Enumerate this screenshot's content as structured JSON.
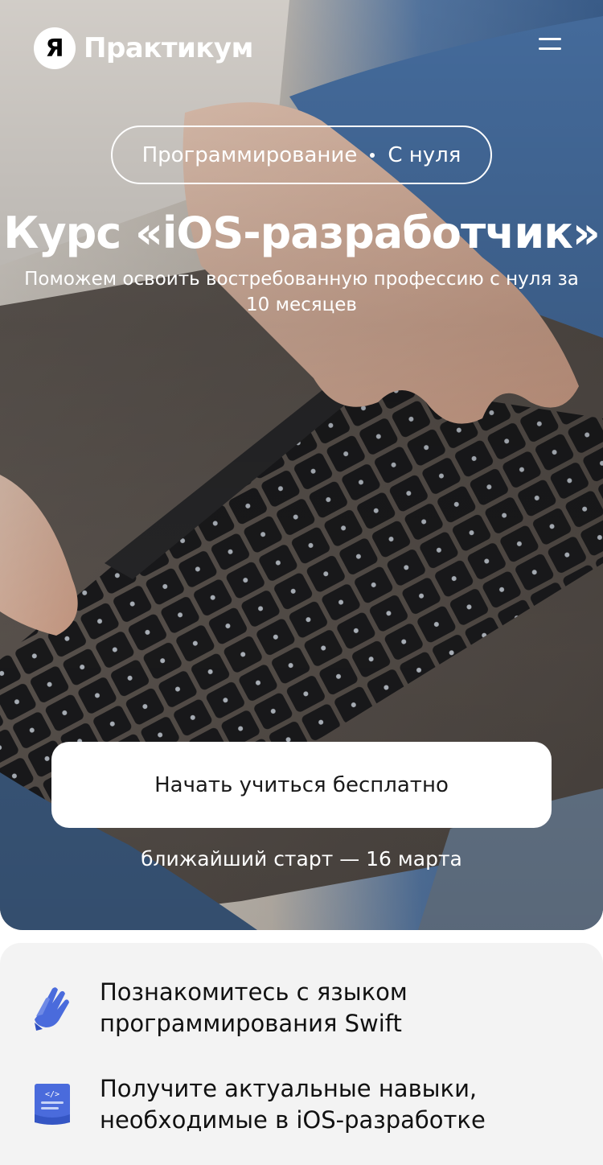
{
  "header": {
    "logo_mark": "Я",
    "logo_text": "Практикум",
    "menu_icon": "hamburger-icon"
  },
  "hero": {
    "pill_category": "Программирование",
    "pill_level": "С нуля",
    "title": "Курс «iOS-разработчик»",
    "subtitle": "Поможем освоить востребованную профессию с нуля за 10 месяцев",
    "cta_label": "Начать учиться бесплатно",
    "start_text": "ближайший старт — 16 марта"
  },
  "features": [
    {
      "icon": "clap-hands-icon",
      "text": "Познакомитесь с языком программирования Swift"
    },
    {
      "icon": "code-document-icon",
      "text": "Получите актуальные навыки, необходимые в iOS-разработке"
    }
  ],
  "colors": {
    "accent_blue": "#4a6bdc",
    "features_bg": "#f3f3f3",
    "cta_bg": "#ffffff"
  }
}
